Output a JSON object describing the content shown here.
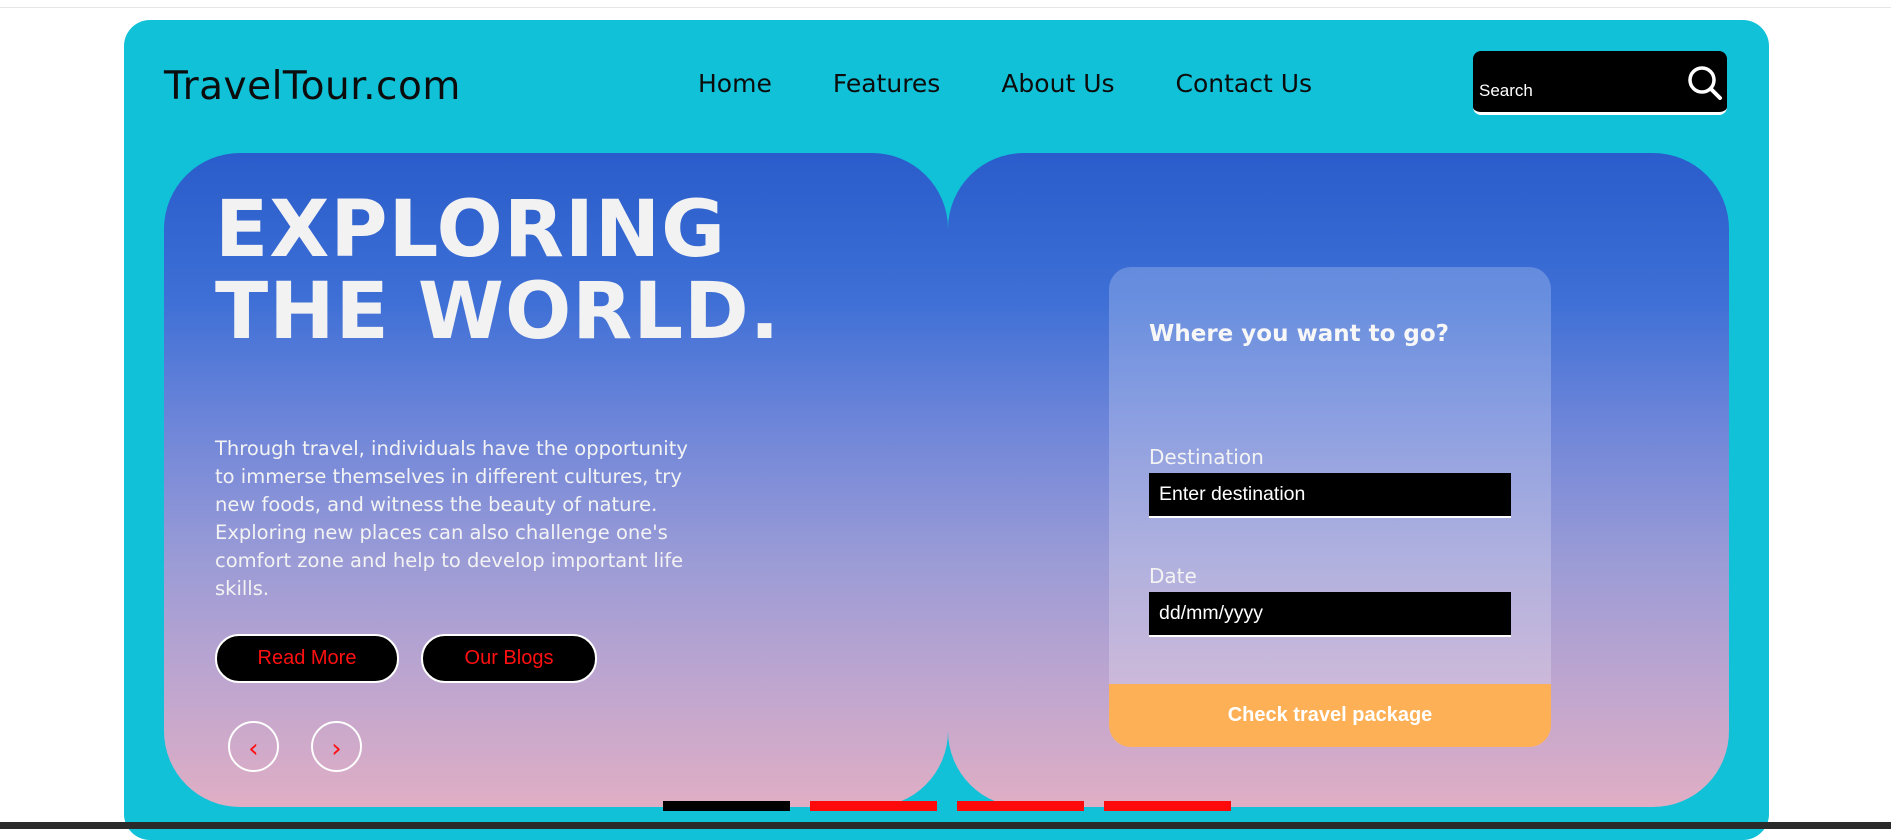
{
  "header": {
    "logo": "TravelTour.com",
    "nav": [
      "Home",
      "Features",
      "About Us",
      "Contact Us"
    ],
    "search_placeholder": "Search"
  },
  "hero": {
    "title_line1": "EXPLORING",
    "title_line2": "THE WORLD.",
    "description": "Through travel, individuals have the opportunity to immerse themselves in different cultures, try new foods, and witness the beauty of nature. Exploring new places can also challenge one's comfort zone and help to develop important life skills.",
    "read_more": "Read More",
    "our_blogs": "Our Blogs",
    "prev_arrow": "‹",
    "next_arrow": "›"
  },
  "booking": {
    "heading": "Where you want to go?",
    "destination_label": "Destination",
    "destination_placeholder": "Enter destination",
    "date_label": "Date",
    "date_placeholder": "dd/mm/yyyy",
    "submit": "Check travel package"
  },
  "carousel": {
    "slides": 4,
    "active_index": 0,
    "active_color": "#000000",
    "inactive_color": "#ff0a0a"
  },
  "colors": {
    "header_bg": "#10c1d8",
    "button_cta": "#fdb055",
    "accent_text": "#ff1010"
  }
}
